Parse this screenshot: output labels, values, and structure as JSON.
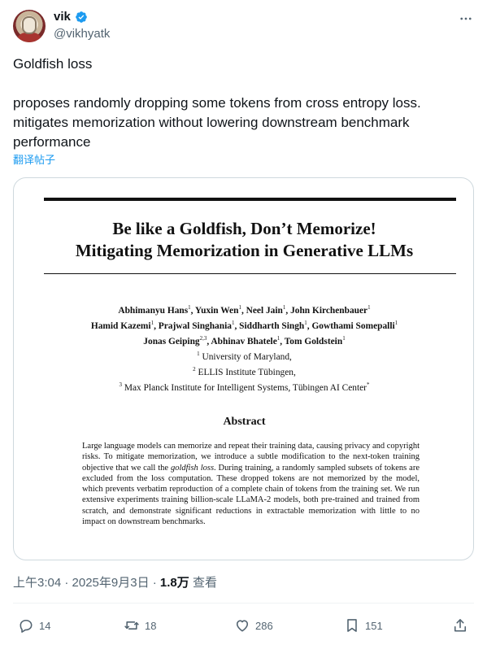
{
  "author": {
    "name": "vik",
    "handle": "@vikhyatk",
    "verified": true
  },
  "tweet": {
    "text": "Goldfish loss\n\nproposes randomly dropping some tokens from cross entropy loss. mitigates memorization without lowering downstream benchmark performance",
    "translate_label": "翻译帖子"
  },
  "paper": {
    "title_line1": "Be like a Goldfish, Don’t Memorize!",
    "title_line2": "Mitigating Memorization in Generative LLMs",
    "authors_line1_a": "Abhimanyu Hans",
    "authors_line1_b": ", Yuxin Wen",
    "authors_line1_c": ", Neel Jain",
    "authors_line1_d": ", John Kirchenbauer",
    "authors_line2_a": "Hamid Kazemi",
    "authors_line2_b": ", Prajwal Singhania",
    "authors_line2_c": ", Siddharth Singh",
    "authors_line2_d": ", Gowthami Somepalli",
    "authors_line3_a": "Jonas Geiping",
    "authors_line3_b": ", Abhinav Bhatele",
    "authors_line3_c": ", Tom Goldstein",
    "sup_1": "1",
    "sup_23": "2,3",
    "affiliation_1": "University of Maryland,",
    "affiliation_2": "ELLIS Institute Tübingen,",
    "affiliation_3": "Max Planck Institute for Intelligent Systems, Tübingen AI Center",
    "affil_num_1": "1",
    "affil_num_2": "2",
    "affil_num_3": "3",
    "affil_star": "*",
    "abstract_heading": "Abstract",
    "abstract_part1": "Large language models can memorize and repeat their training data, causing privacy and copyright risks. To mitigate memorization, we introduce a subtle modification to the next-token training objective that we call the ",
    "abstract_italic": "goldfish loss",
    "abstract_part2": ". During training, a randomly sampled subsets of tokens are excluded from the loss computation. These dropped tokens are not memorized by the model, which prevents verbatim reproduction of a complete chain of tokens from the training set. We run extensive experiments training billion-scale LLaMA-2 models, both pre-trained and trained from scratch, and demonstrate significant reductions in extractable memorization with little to no impact on downstream benchmarks."
  },
  "meta": {
    "time": "上午3:04 · 2025年9月3日 · ",
    "views_count": "1.8万",
    "views_label": " 查看"
  },
  "actions": {
    "replies": "14",
    "reposts": "18",
    "likes": "286",
    "bookmarks": "151"
  },
  "colors": {
    "accent": "#1d9bf0",
    "secondary_text": "#536471",
    "primary_text": "#0f1419",
    "border": "#cfd9de"
  },
  "icons": [
    "verified-badge-icon",
    "more-icon",
    "reply-icon",
    "repost-icon",
    "like-icon",
    "bookmark-icon",
    "share-icon"
  ]
}
